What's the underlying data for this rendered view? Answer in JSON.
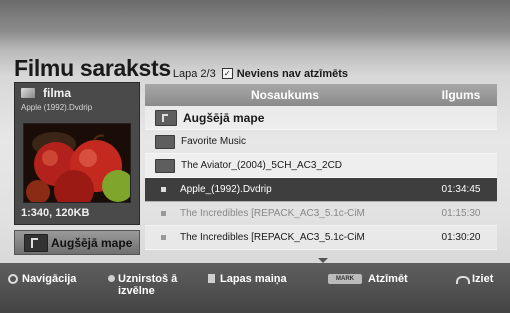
{
  "header": {
    "title": "Filmu saraksts",
    "page": "Lapa 2/3",
    "check_mark": "✓",
    "no_marked": "Neviens nav atzīmēts"
  },
  "preview": {
    "name": "filma",
    "file": "Apple (1992).Dvdrip",
    "info": "1:340, 120KB"
  },
  "up_button": {
    "label": "Augšējā mape"
  },
  "list": {
    "col_name": "Nosaukums",
    "col_duration": "Ilgums",
    "rows": [
      {
        "name": "Augšējā mape",
        "duration": ""
      },
      {
        "name": "Favorite Music",
        "duration": ""
      },
      {
        "name": "The Aviator_(2004)_5CH_AC3_2CD",
        "duration": ""
      },
      {
        "name": "Apple_(1992).Dvdrip",
        "duration": "01:34:45"
      },
      {
        "name": "The Incredibles [REPACK_AC3_5.1c-CiM",
        "duration": "01:15:30"
      },
      {
        "name": "The Incredibles [REPACK_AC3_5.1c-CiM",
        "duration": "01:30:20"
      }
    ]
  },
  "footer": {
    "navigation": "Navigācija",
    "popup_menu": "Uznirstoš ā izvēlne",
    "page_change": "Lapas maiņa",
    "mark_key": "MARK",
    "mark": "Atzīmēt",
    "exit": "Iziet"
  }
}
